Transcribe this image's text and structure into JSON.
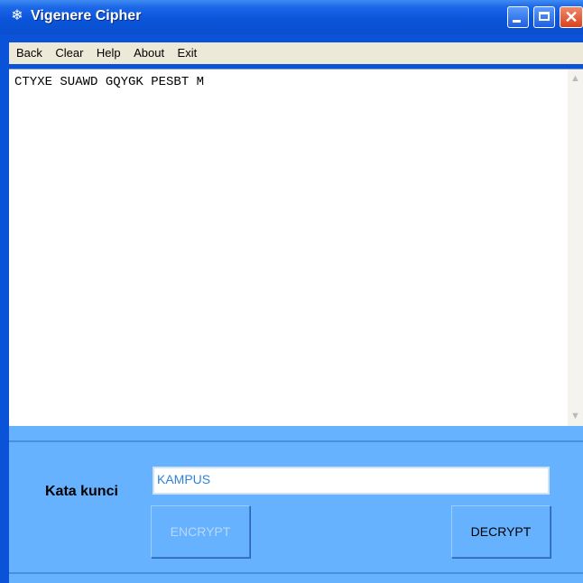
{
  "window": {
    "title": "Vigenere Cipher",
    "app_icon": "snowflake-icon",
    "title_bar_color": "#0a53d8"
  },
  "menu": {
    "items": [
      "Back",
      "Clear",
      "Help",
      "About",
      "Exit"
    ]
  },
  "editor": {
    "text": "CTYXE SUAWD GQYGK PESBT M"
  },
  "form": {
    "key_label": "Kata kunci",
    "key_value": "KAMPUS",
    "encrypt_label": "ENCRYPT",
    "decrypt_label": "DECRYPT",
    "panel_color": "#66b2ff"
  }
}
